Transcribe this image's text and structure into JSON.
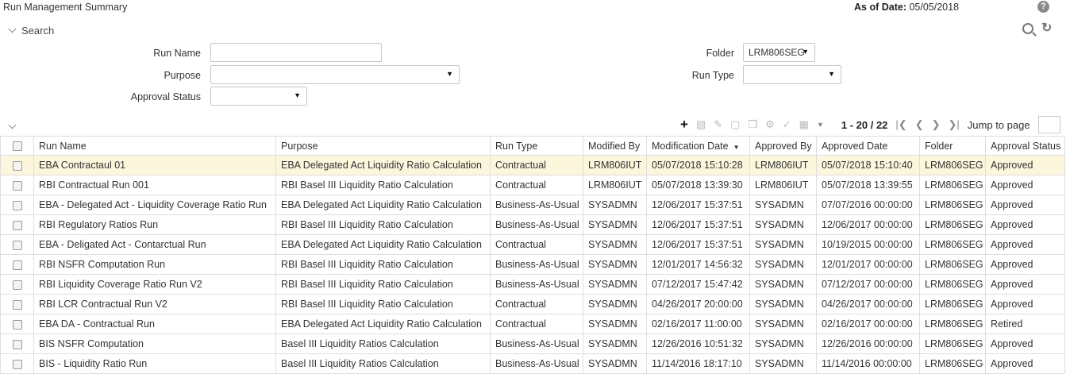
{
  "header": {
    "title": "Run Management Summary",
    "as_of_label": "As of Date:",
    "as_of_value": "05/05/2018",
    "help_icon": "?"
  },
  "search": {
    "label": "Search",
    "run_name_label": "Run Name",
    "run_name_value": "",
    "purpose_label": "Purpose",
    "purpose_value": "",
    "approval_status_label": "Approval Status",
    "approval_status_value": "",
    "folder_label": "Folder",
    "folder_value": "LRM806SEG",
    "run_type_label": "Run Type",
    "run_type_value": ""
  },
  "toolbar": {
    "page_range": "1 - 20 / 22",
    "jump_label": "Jump to page",
    "jump_value": ""
  },
  "table": {
    "columns": [
      "Run Name",
      "Purpose",
      "Run Type",
      "Modified By",
      "Modification Date",
      "Approved By",
      "Approved Date",
      "Folder",
      "Approval Status"
    ],
    "rows": [
      [
        "EBA Contractaul 01",
        "EBA Delegated Act Liquidity Ratio Calculation",
        "Contractual",
        "LRM806IUT",
        "05/07/2018 15:10:28",
        "LRM806IUT",
        "05/07/2018 15:10:40",
        "LRM806SEG",
        "Approved"
      ],
      [
        "RBI Contractual Run 001",
        "RBI Basel III Liquidity Ratio Calculation",
        "Contractual",
        "LRM806IUT",
        "05/07/2018 13:39:30",
        "LRM806IUT",
        "05/07/2018 13:39:55",
        "LRM806SEG",
        "Approved"
      ],
      [
        "EBA - Delegated Act - Liquidity Coverage Ratio Run",
        "EBA Delegated Act Liquidity Ratio Calculation",
        "Business-As-Usual",
        "SYSADMN",
        "12/06/2017 15:37:51",
        "SYSADMN",
        "07/07/2016 00:00:00",
        "LRM806SEG",
        "Approved"
      ],
      [
        "RBI Regulatory Ratios Run",
        "RBI Basel III Liquidity Ratio Calculation",
        "Business-As-Usual",
        "SYSADMN",
        "12/06/2017 15:37:51",
        "SYSADMN",
        "12/06/2017 00:00:00",
        "LRM806SEG",
        "Approved"
      ],
      [
        "EBA - Deligated Act - Contarctual Run",
        "EBA Delegated Act Liquidity Ratio Calculation",
        "Contractual",
        "SYSADMN",
        "12/06/2017 15:37:51",
        "SYSADMN",
        "10/19/2015 00:00:00",
        "LRM806SEG",
        "Approved"
      ],
      [
        "RBI NSFR Computation Run",
        "RBI Basel III Liquidity Ratio Calculation",
        "Business-As-Usual",
        "SYSADMN",
        "12/01/2017 14:56:32",
        "SYSADMN",
        "12/01/2017 00:00:00",
        "LRM806SEG",
        "Approved"
      ],
      [
        "RBI Liquidity Coverage Ratio Run V2",
        "RBI Basel III Liquidity Ratio Calculation",
        "Business-As-Usual",
        "SYSADMN",
        "07/12/2017 15:47:42",
        "SYSADMN",
        "07/12/2017 00:00:00",
        "LRM806SEG",
        "Approved"
      ],
      [
        "RBI LCR Contractual Run V2",
        "RBI Basel III Liquidity Ratio Calculation",
        "Contractual",
        "SYSADMN",
        "04/26/2017 20:00:00",
        "SYSADMN",
        "04/26/2017 00:00:00",
        "LRM806SEG",
        "Approved"
      ],
      [
        "EBA DA - Contractual Run",
        "EBA Delegated Act Liquidity Ratio Calculation",
        "Contractual",
        "SYSADMN",
        "02/16/2017 11:00:00",
        "SYSADMN",
        "02/16/2017 00:00:00",
        "LRM806SEG",
        "Retired"
      ],
      [
        "BIS NSFR Computation",
        "Basel III Liquidity Ratios Calculation",
        "Business-As-Usual",
        "SYSADMN",
        "12/26/2016 10:51:32",
        "SYSADMN",
        "12/26/2016 00:00:00",
        "LRM806SEG",
        "Approved"
      ],
      [
        "BIS - Liquidity Ratio Run",
        "Basel III Liquidity Ratios Calculation",
        "Business-As-Usual",
        "SYSADMN",
        "11/14/2016 18:17:10",
        "SYSADMN",
        "11/14/2016 00:00:00",
        "LRM806SEG",
        "Approved"
      ]
    ]
  }
}
